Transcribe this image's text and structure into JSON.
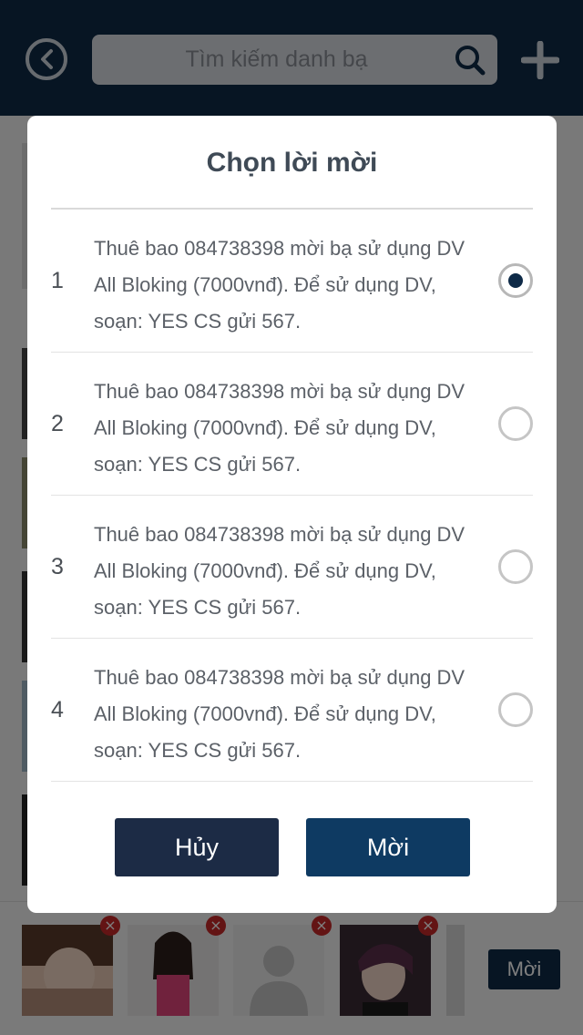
{
  "header": {
    "search_placeholder": "Tìm kiếm danh bạ"
  },
  "icons": {
    "back": "back-arrow-icon",
    "search": "search-icon",
    "add": "plus-icon",
    "remove": "close-icon"
  },
  "dialog": {
    "title": "Chọn lời mời",
    "options": [
      {
        "number": "1",
        "text": "Thuê bao 084738398 mời bạ sử dụng DV All Bloking (7000vnđ). Để sử dụng DV, soạn: YES CS gửi 567.",
        "selected": true
      },
      {
        "number": "2",
        "text": "Thuê bao 084738398 mời bạ sử dụng DV All Bloking (7000vnđ). Để sử dụng DV, soạn: YES CS gửi 567.",
        "selected": false
      },
      {
        "number": "3",
        "text": "Thuê bao 084738398 mời bạ sử dụng DV All Bloking (7000vnđ). Để sử dụng DV, soạn: YES CS gửi 567.",
        "selected": false
      },
      {
        "number": "4",
        "text": "Thuê bao 084738398 mời bạ sử dụng DV All Bloking (7000vnđ). Để sử dụng DV, soạn: YES CS gửi 567.",
        "selected": false
      }
    ],
    "cancel_label": "Hủy",
    "invite_label": "Mời"
  },
  "bottom_bar": {
    "invite_label": "Mời",
    "selected_contacts_count": 4
  },
  "colors": {
    "header_bg": "#0e2a47",
    "primary_button": "#0e3a62",
    "cancel_button": "#1c2b45",
    "remove_badge": "#c62828"
  }
}
